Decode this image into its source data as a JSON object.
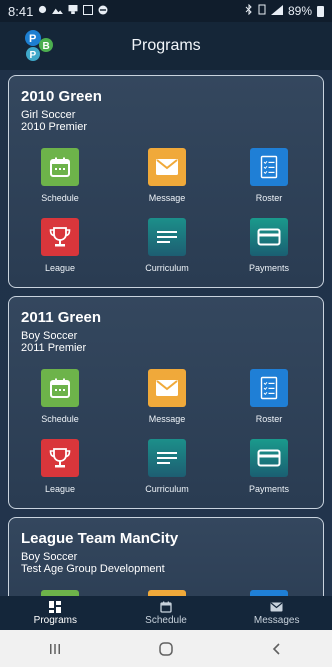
{
  "status_bar": {
    "time": "8:41",
    "battery": "89%"
  },
  "header": {
    "title": "Programs"
  },
  "teams": [
    {
      "name": "2010 Green",
      "sport": "Girl Soccer",
      "group": "2010 Premier",
      "tiles": [
        "Schedule",
        "Message",
        "Roster",
        "League",
        "Curriculum",
        "Payments"
      ]
    },
    {
      "name": "2011 Green",
      "sport": "Boy Soccer",
      "group": "2011 Premier",
      "tiles": [
        "Schedule",
        "Message",
        "Roster",
        "League",
        "Curriculum",
        "Payments"
      ]
    },
    {
      "name": "League Team ManCity",
      "sport": "Boy Soccer",
      "group": "Test Age Group Development"
    }
  ],
  "bottom_nav": {
    "items": [
      {
        "label": "Programs",
        "icon": "programs-icon",
        "active": true
      },
      {
        "label": "Schedule",
        "icon": "calendar-icon",
        "active": false
      },
      {
        "label": "Messages",
        "icon": "mail-icon",
        "active": false
      }
    ]
  },
  "colors": {
    "schedule": "#6db34a",
    "message": "#f0a93a",
    "roster": "#1f7fd6",
    "league": "#d9363b",
    "curriculum": "#1c8f8a",
    "payments": "#1a9a8c"
  }
}
